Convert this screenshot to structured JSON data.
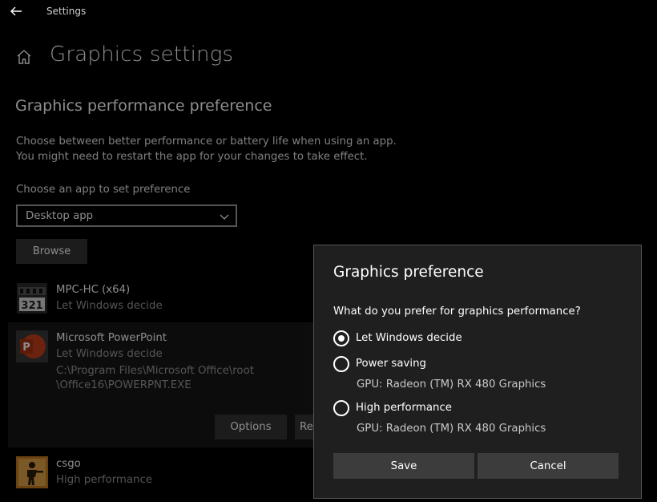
{
  "titlebar": {
    "back_icon": "back-arrow-icon",
    "title": "Settings"
  },
  "page": {
    "home_icon": "home-icon",
    "title": "Graphics settings",
    "section_title": "Graphics performance preference",
    "description_line1": "Choose between better performance or battery life when using an app.",
    "description_line2": "You might need to restart the app for your changes to take effect.",
    "choose_label": "Choose an app to set preference",
    "dropdown_value": "Desktop app",
    "browse_label": "Browse"
  },
  "apps": [
    {
      "name": "MPC-HC (x64)",
      "status": "Let Windows decide",
      "icon": "mpc-hc-icon"
    },
    {
      "name": "Microsoft PowerPoint",
      "status": "Let Windows decide",
      "icon": "powerpoint-icon",
      "path_line1": "C:\\Program Files\\Microsoft Office\\root",
      "path_line2": "\\Office16\\POWERPNT.EXE",
      "options_label": "Options",
      "remove_label": "Remove"
    },
    {
      "name": "csgo",
      "status": "High performance",
      "icon": "csgo-icon"
    }
  ],
  "dialog": {
    "title": "Graphics preference",
    "question": "What do you prefer for graphics performance?",
    "options": [
      {
        "label": "Let Windows decide",
        "checked": true
      },
      {
        "label": "Power saving",
        "sub": "GPU: Radeon (TM) RX 480 Graphics",
        "checked": false
      },
      {
        "label": "High performance",
        "sub": "GPU: Radeon (TM) RX 480 Graphics",
        "checked": false
      }
    ],
    "save_label": "Save",
    "cancel_label": "Cancel"
  },
  "colors": {
    "background": "#000000",
    "dialog_bg": "#1f1f1f",
    "button_bg": "#3c3c3c",
    "powerpoint": "#c43e1c"
  }
}
